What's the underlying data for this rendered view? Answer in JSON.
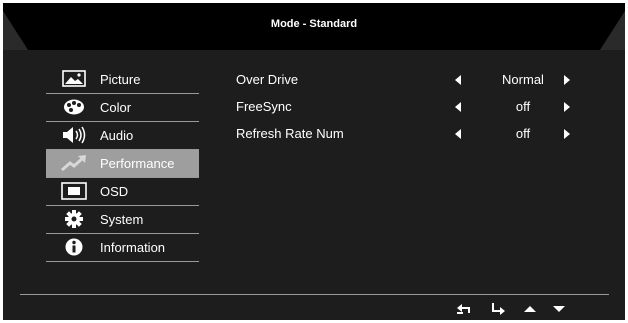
{
  "header": {
    "title": "Mode - Standard"
  },
  "menu": {
    "items": [
      {
        "label": "Picture",
        "icon": "picture-icon",
        "active": false
      },
      {
        "label": "Color",
        "icon": "palette-icon",
        "active": false
      },
      {
        "label": "Audio",
        "icon": "speaker-icon",
        "active": false
      },
      {
        "label": "Performance",
        "icon": "performance-icon",
        "active": true
      },
      {
        "label": "OSD",
        "icon": "osd-icon",
        "active": false
      },
      {
        "label": "System",
        "icon": "gear-icon",
        "active": false
      },
      {
        "label": "Information",
        "icon": "info-icon",
        "active": false
      }
    ]
  },
  "settings": [
    {
      "label": "Over Drive",
      "value": "Normal"
    },
    {
      "label": "FreeSync",
      "value": "off"
    },
    {
      "label": "Refresh Rate Num",
      "value": "off"
    }
  ],
  "nav": {
    "icons": [
      "back-icon",
      "enter-icon",
      "up-arrow-icon",
      "down-arrow-icon"
    ]
  },
  "colors": {
    "background": "#1d1d1d",
    "header": "#000000",
    "active_item": "#9e9e9e",
    "text": "#ffffff",
    "divider": "#9a9a9a"
  }
}
